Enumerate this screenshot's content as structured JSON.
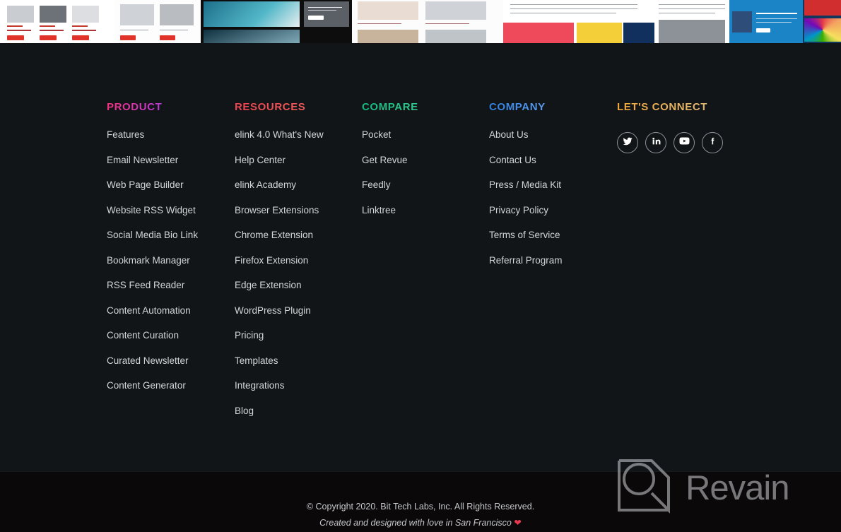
{
  "top_strip": {
    "description": "scrolling row of newsletter and web page template thumbnails",
    "thumbnails": [
      {
        "name": "news-grid-template",
        "style": "white-cards-red-buttons"
      },
      {
        "name": "article-cards-template",
        "style": "white-three-card"
      },
      {
        "name": "ocean-hero-template",
        "style": "dark-photo-hero"
      },
      {
        "name": "chapter-list-template",
        "style": "light-chapters"
      },
      {
        "name": "illustration-template",
        "style": "red-yellow-blocks"
      },
      {
        "name": "long-read-template",
        "style": "white-text-article"
      },
      {
        "name": "interview-template",
        "style": "portrait-photo"
      },
      {
        "name": "blue-feature-template",
        "style": "blue-card"
      },
      {
        "name": "design-colors-template",
        "style": "navy-color-wheel"
      },
      {
        "name": "recipe-template",
        "style": "dark-food-cards"
      }
    ]
  },
  "footer": {
    "columns": [
      {
        "id": "product",
        "heading": "PRODUCT",
        "accent": "#f2317f",
        "links": [
          "Features",
          "Email Newsletter",
          "Web Page Builder",
          "Website RSS Widget",
          "Social Media Bio Link",
          "Bookmark Manager",
          "RSS Feed Reader",
          "Content Automation",
          "Content Curation",
          "Curated Newsletter",
          "Content Generator"
        ]
      },
      {
        "id": "resources",
        "heading": "RESOURCES",
        "accent": "#e8434f",
        "links": [
          "elink 4.0 What's New",
          "Help Center",
          "elink Academy",
          "Browser Extensions",
          "Chrome Extension",
          "Firefox Extension",
          "Edge Extension",
          "WordPress Plugin",
          "Pricing",
          "Templates",
          "Integrations",
          "Blog"
        ]
      },
      {
        "id": "compare",
        "heading": "COMPARE",
        "accent": "#15b87e",
        "links": [
          "Pocket",
          "Get Revue",
          "Feedly",
          "Linktree"
        ]
      },
      {
        "id": "company",
        "heading": "COMPANY",
        "accent": "#2f7fe0",
        "links": [
          "About Us",
          "Contact Us",
          "Press / Media Kit",
          "Privacy Policy",
          "Terms of Service",
          "Referral Program"
        ]
      }
    ],
    "connect": {
      "heading": "LET'S CONNECT",
      "accent": "#f0a63c",
      "socials": [
        {
          "name": "twitter-icon",
          "label": "Twitter"
        },
        {
          "name": "linkedin-icon",
          "label": "LinkedIn"
        },
        {
          "name": "youtube-icon",
          "label": "YouTube"
        },
        {
          "name": "facebook-icon",
          "label": "Facebook"
        }
      ]
    }
  },
  "bottom": {
    "copyright": "© Copyright 2020. Bit Tech Labs, Inc. All Rights Reserved.",
    "tagline_before": "Created and designed with love in San Francisco ",
    "heart": "❤",
    "watermark": "Revain"
  }
}
